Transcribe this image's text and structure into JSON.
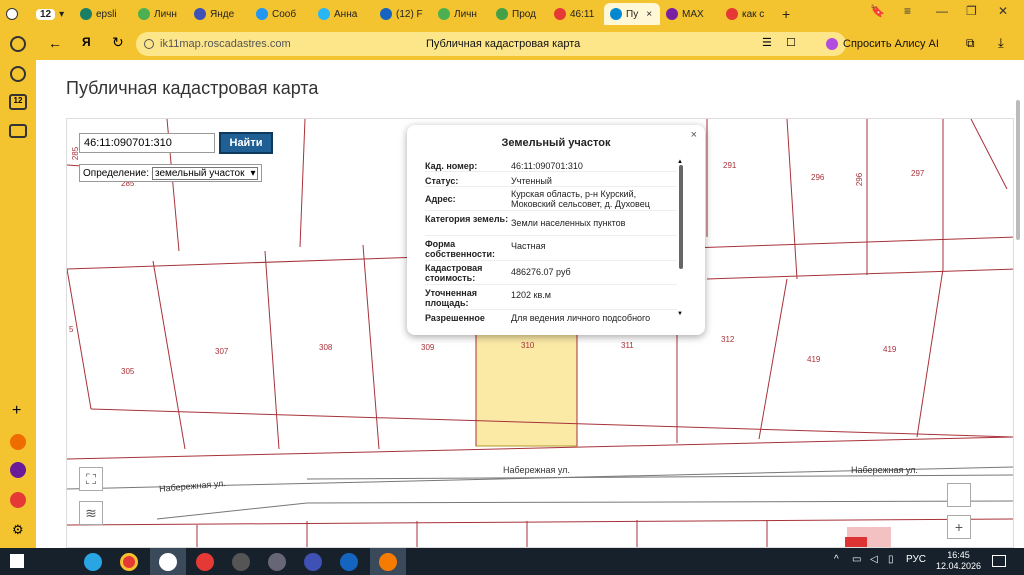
{
  "browser": {
    "tab_count_badge": "12",
    "tabs": [
      {
        "label": "epsli",
        "color": "#1a7f64"
      },
      {
        "label": "Личн",
        "color": "#4caf50"
      },
      {
        "label": "Яндe",
        "color": "#3f51b5"
      },
      {
        "label": "Сооб",
        "color": "#2196f3"
      },
      {
        "label": "Анна",
        "color": "#29b6f6"
      },
      {
        "label": "(12) F",
        "color": "#1565c0"
      },
      {
        "label": "Личн",
        "color": "#4caf50"
      },
      {
        "label": "Прод",
        "color": "#43a047"
      },
      {
        "label": "46:11",
        "color": "#e53935"
      },
      {
        "label": "Пу",
        "color": "#0288d1",
        "active": true
      },
      {
        "label": "MAX",
        "color": "#7b1fa2"
      },
      {
        "label": "как с",
        "color": "#e53935"
      }
    ],
    "url": "ik11map.roscadastres.com",
    "page_title": "Публичная кадастровая карта",
    "alice_label": "Спросить Алису AI"
  },
  "page": {
    "heading": "Публичная кадастровая карта"
  },
  "search": {
    "value": "46:11:090701:310",
    "button": "Найти",
    "def_label": "Определение:",
    "def_value": "земельный участок"
  },
  "popup": {
    "title": "Земельный участок",
    "close": "×",
    "rows": [
      {
        "k": "Кад. номер:",
        "v": "46:11:090701:310"
      },
      {
        "k": "Статус:",
        "v": "Учтенный"
      },
      {
        "k": "Адрес:",
        "v": "Курская область, р-н Курский, Моковский сельсовет, д. Духовец"
      },
      {
        "k": "Категория земель:",
        "v": "Земли населенных пунктов"
      },
      {
        "k": "Форма собственности:",
        "v": "Частная"
      },
      {
        "k": "Кадастровая стоимость:",
        "v": "486276.07 руб"
      },
      {
        "k": "Уточненная площадь:",
        "v": "1202 кв.м"
      },
      {
        "k": "Разрешенное",
        "v": "Для ведения личного подсобного"
      }
    ]
  },
  "map": {
    "parcel_labels": [
      "285",
      "285",
      "291",
      "296",
      "296",
      "297",
      "305",
      "307",
      "308",
      "309",
      "310",
      "311",
      "312",
      "419",
      "419",
      "5"
    ],
    "street_labels": [
      "Набережная ул.",
      "Набережная ул.",
      "Набережная ул."
    ],
    "highlight_color": "#fbe9a6"
  },
  "taskbar": {
    "lang": "РУС",
    "time": "16:45",
    "date": "12.04.2026"
  }
}
